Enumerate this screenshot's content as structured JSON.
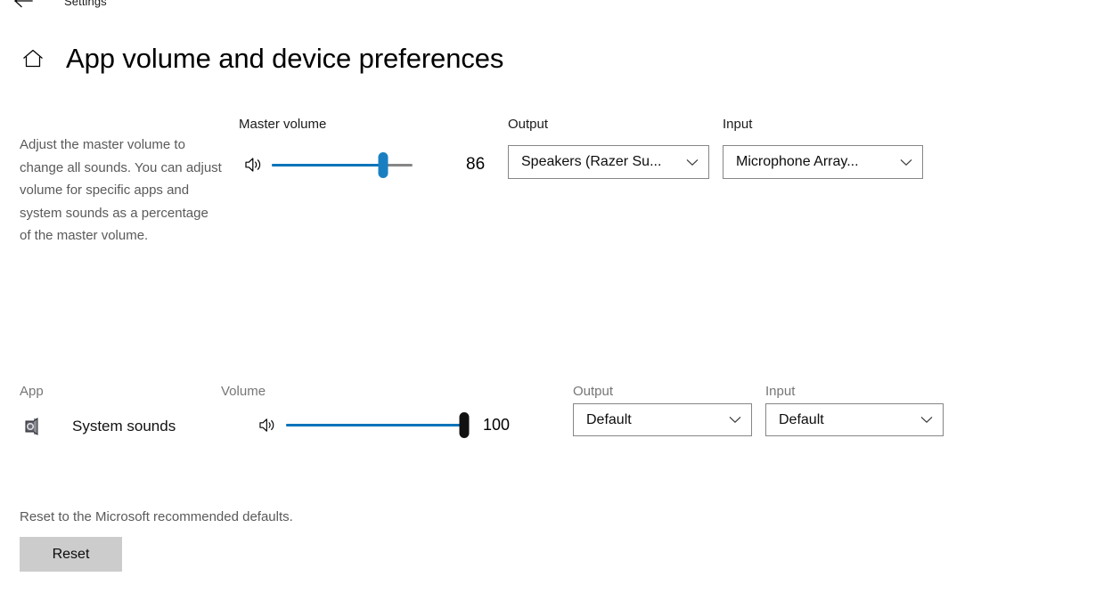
{
  "window": {
    "back_icon": "back-arrow-icon",
    "app_name": "Settings"
  },
  "header": {
    "home_icon": "home-icon",
    "title": "App volume and device preferences"
  },
  "master": {
    "description": "Adjust the master volume to change all sounds. You can adjust volume for specific apps and system sounds as a percentage of the master volume.",
    "volume_label": "Master volume",
    "volume_icon": "speaker-icon",
    "volume_value": "86",
    "volume_percent": 86,
    "output_label": "Output",
    "output_value": "Speakers (Razer Su...",
    "input_label": "Input",
    "input_value": "Microphone Array...",
    "chevron_icon": "chevron-down-icon"
  },
  "apps": {
    "col_app": "App",
    "col_volume": "Volume",
    "col_output": "Output",
    "col_input": "Input",
    "rows": [
      {
        "icon": "system-sounds-icon",
        "name": "System sounds",
        "volume_icon": "speaker-icon",
        "volume_value": "100",
        "volume_percent": 100,
        "output_value": "Default",
        "input_value": "Default"
      }
    ]
  },
  "reset": {
    "description": "Reset to the Microsoft recommended defaults.",
    "button_label": "Reset"
  },
  "colors": {
    "accent_blue": "#0a74ba",
    "thumb_blue": "#1a7fc1",
    "track_gray": "#868686",
    "muted_text": "#5a5a5a",
    "button_gray": "#cccccc",
    "background": "#ffffff"
  }
}
